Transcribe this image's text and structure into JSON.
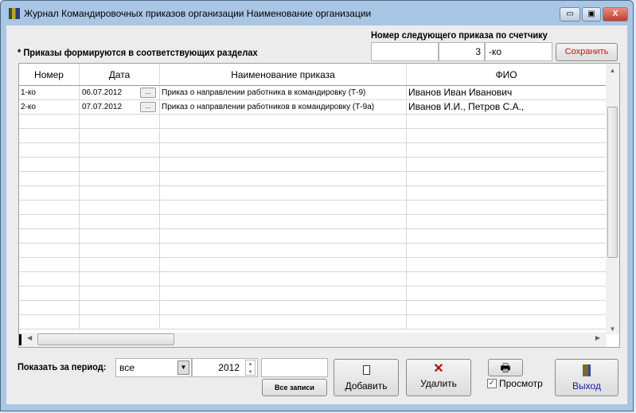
{
  "window": {
    "title": "Журнал Командировочных приказов организации  Наименование организации",
    "minimize": "▭",
    "maximize": "▣",
    "close": "X"
  },
  "header": {
    "note": "* Приказы формируются в соответствующих разделах",
    "counter_label": "Номер следующего приказа по счетчику",
    "counter_prefix": "",
    "counter_number": "3",
    "counter_suffix": "-ко",
    "save_label": "Сохранить",
    "save_color": "#d01010"
  },
  "table": {
    "columns": [
      "Номер",
      "Дата",
      "Наименование приказа",
      "ФИО"
    ],
    "rows": [
      {
        "number": "1-ко",
        "date": "06.07.2012",
        "name": "Приказ о направлении работника в командировку (Т-9)",
        "fio": "Иванов Иван Иванович"
      },
      {
        "number": "2-ко",
        "date": "07.07.2012",
        "name": "Приказ о направлении работников в командировку (Т-9а)",
        "fio": "Иванов И.И., Петров С.А.,"
      }
    ],
    "date_button": "..."
  },
  "footer": {
    "period_label": "Показать за период:",
    "period_value": "все",
    "year": "2012",
    "search_value": "",
    "all_records": "Все записи",
    "add": "Добавить",
    "delete": "Удалить",
    "preview": "Просмотр",
    "preview_checked": true,
    "exit": "Выход",
    "exit_color": "#1a1aa0",
    "delete_icon_color": "#b01010"
  }
}
